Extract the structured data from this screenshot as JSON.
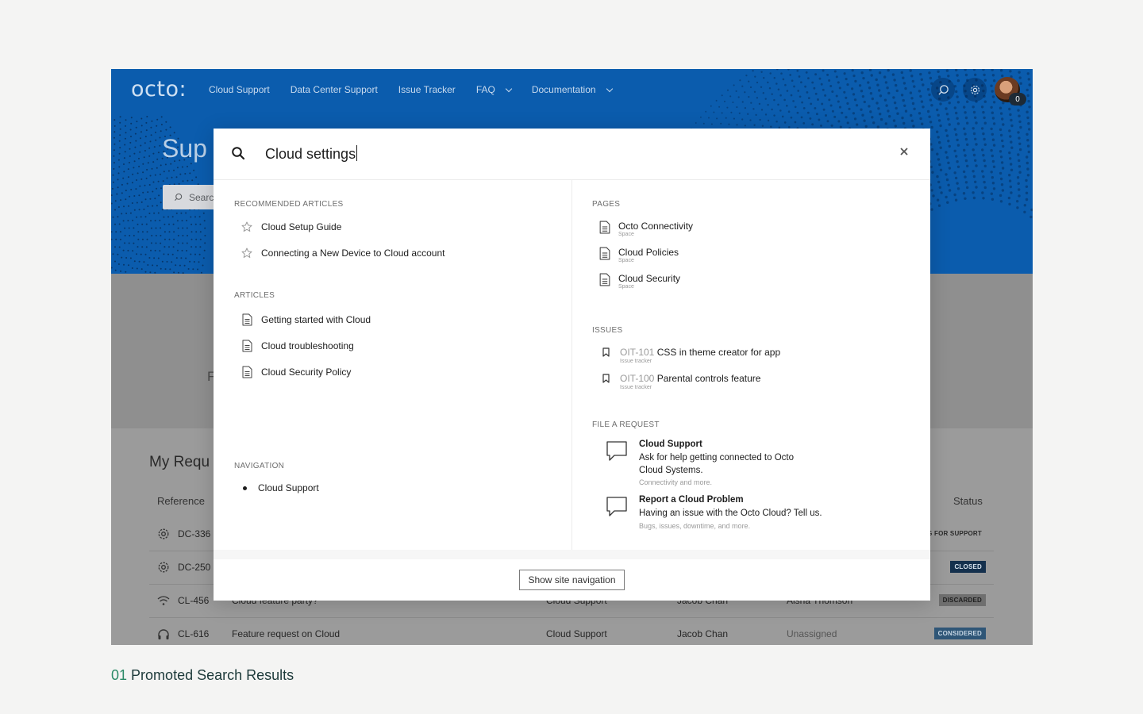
{
  "app": {
    "logo": "octo:",
    "nav": [
      "Cloud Support",
      "Data Center Support",
      "Issue Tracker",
      "FAQ",
      "Documentation"
    ],
    "avatar_badge": "0",
    "hero_title": "Sup",
    "hero_search_placeholder": "Searc",
    "mid_letter": "F",
    "my_requests_title": "My Requ",
    "table_headers": {
      "reference": "Reference",
      "status": "Status"
    },
    "rows": [
      {
        "icon": "gear-icon",
        "ref": "DC-336",
        "summary": "",
        "project": "",
        "reporter": "",
        "assignee": "",
        "status": "ING FOR SUPPORT"
      },
      {
        "icon": "gear-icon",
        "ref": "DC-250",
        "summary": "",
        "project": "",
        "reporter": "",
        "assignee": "",
        "status": "CLOSED"
      },
      {
        "icon": "wifi-icon",
        "ref": "CL-456",
        "summary": "Cloud feature party?",
        "project": "Cloud Support",
        "reporter": "Jacob Chan",
        "assignee": "Aisha Thomson",
        "status": "DISCARDED"
      },
      {
        "icon": "headset-icon",
        "ref": "CL-616",
        "summary": "Feature request on Cloud",
        "project": "Cloud Support",
        "reporter": "Jacob Chan",
        "assignee": "Unassigned",
        "status": "CONSIDERED"
      }
    ]
  },
  "search": {
    "query": "Cloud settings",
    "sections": {
      "recommended": "RECOMMENDED ARTICLES",
      "articles": "ARTICLES",
      "navigation": "NAVIGATION",
      "pages": "PAGES",
      "issues": "ISSUES",
      "file_request": "FILE A REQUEST"
    },
    "recommended": [
      "Cloud Setup Guide",
      "Connecting a New Device to Cloud account"
    ],
    "articles": [
      "Getting started with Cloud",
      "Cloud troubleshooting",
      "Cloud Security Policy"
    ],
    "navigation": [
      "Cloud Support"
    ],
    "pages": [
      {
        "title": "Octo Connectivity",
        "type": "Space"
      },
      {
        "title": "Cloud Policies",
        "type": "Space"
      },
      {
        "title": "Cloud Security",
        "type": "Space"
      }
    ],
    "issues": [
      {
        "key": "OIT-101",
        "title": "CSS in theme creator for app",
        "source": "Issue tracker"
      },
      {
        "key": "OIT-100",
        "title": "Parental controls feature",
        "source": "Issue tracker"
      }
    ],
    "requests": [
      {
        "title": "Cloud Support",
        "desc": "Ask for help getting connected to Octo Cloud Systems.",
        "sub": "Connectivity and more."
      },
      {
        "title": "Report a Cloud Problem",
        "desc": "Having an issue with the Octo Cloud? Tell us.",
        "sub": "Bugs, issues, downtime, and more."
      }
    ],
    "footer_button": "Show site navigation"
  },
  "caption": {
    "number": "01",
    "text": "Promoted Search Results"
  },
  "colors": {
    "brand_blue": "#0b5cad",
    "caption_accent": "#2b8a67"
  }
}
